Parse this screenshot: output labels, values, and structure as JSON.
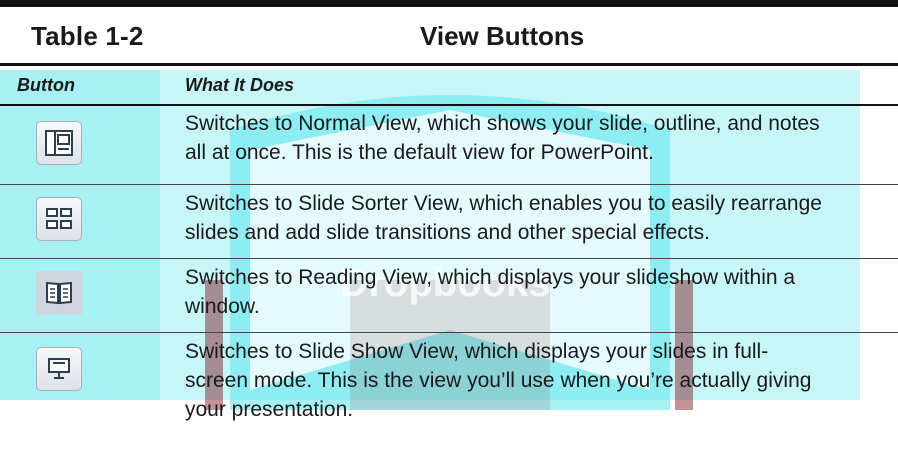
{
  "table": {
    "number": "Table 1-2",
    "title": "View Buttons"
  },
  "columns": {
    "button": "Button",
    "what": "What It Does"
  },
  "rows": [
    {
      "icon": "normal-view-icon",
      "lines": [
        "Switches to Normal View, which shows your slide, outline, and notes",
        "all at once. This is the default view for PowerPoint."
      ]
    },
    {
      "icon": "slide-sorter-icon",
      "lines": [
        "Switches to Slide Sorter View, which enables you to easily rearrange",
        "slides and add slide transitions and other special effects."
      ]
    },
    {
      "icon": "reading-view-icon",
      "lines": [
        "Switches to Reading View, which displays your slideshow within a",
        "window."
      ]
    },
    {
      "icon": "slide-show-icon",
      "lines": [
        "Switches to Slide Show View, which displays your slides in full-",
        "screen mode. This is the view you’ll use when you’re actually giving",
        "your presentation."
      ]
    }
  ],
  "watermark": {
    "text": "Dropbooks"
  },
  "colors": {
    "watermark_cyan": "#4fe0e8",
    "watermark_maroon": "#7a1018",
    "icon_stroke": "#2c3e50"
  }
}
